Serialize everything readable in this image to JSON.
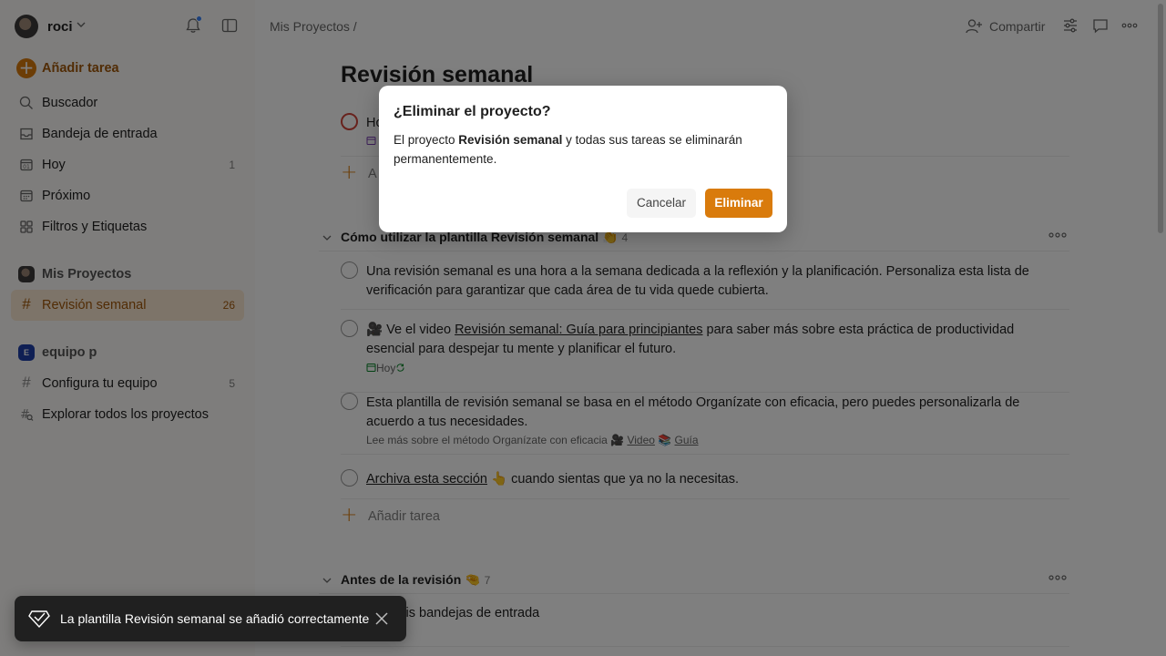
{
  "user": {
    "name": "roci"
  },
  "sidebar": {
    "add_task": "Añadir tarea",
    "items": [
      {
        "label": "Buscador",
        "count": ""
      },
      {
        "label": "Bandeja de entrada",
        "count": ""
      },
      {
        "label": "Hoy",
        "count": "1"
      },
      {
        "label": "Próximo",
        "count": ""
      },
      {
        "label": "Filtros y Etiquetas",
        "count": ""
      }
    ],
    "my_projects": "Mis Proyectos",
    "projects": [
      {
        "label": "Revisión semanal",
        "count": "26"
      }
    ],
    "team": {
      "badge": "E",
      "name": "equipo p"
    },
    "team_projects": [
      {
        "label": "Configura tu equipo",
        "count": "5"
      }
    ],
    "explore": "Explorar todos los proyectos"
  },
  "topbar": {
    "breadcrumb": "Mis Proyectos /",
    "share": "Compartir"
  },
  "page": {
    "title": "Revisión semanal",
    "first_task_partial": "Ho",
    "add_partial": "A",
    "add_task": "Añadir tarea"
  },
  "sections": [
    {
      "title": "Cómo utilizar la plantilla Revisión semanal",
      "emoji": "👏",
      "count": "4",
      "tasks": [
        {
          "text": "Una revisión semanal es una hora a la semana dedicada a la reflexión y la planificación. Personaliza esta lista de verificación para garantizar que cada área de tu vida quede cubierta."
        },
        {
          "prefix": "🎥 Ve el video ",
          "link": "Revisión semanal: Guía para principiantes",
          "suffix": " para saber más sobre esta práctica de productividad esencial para despejar tu mente y planificar el futuro.",
          "due": "Hoy"
        },
        {
          "text": "Esta plantilla de revisión semanal se basa en el método Organízate con eficacia, pero puedes personalizarla de acuerdo a tus necesidades.",
          "desc_prefix": "Lee más sobre el método Organízate con eficacia 🎥 ",
          "desc_link1": "Video",
          "desc_mid": " 📚 ",
          "desc_link2": "Guía"
        },
        {
          "link": "Archiva esta sección",
          "suffix": " 👆 cuando sientas que ya no la necesitas."
        }
      ]
    },
    {
      "title": "Antes de la revisión",
      "emoji": "🤏",
      "count": "7",
      "tasks": [
        {
          "text": "…ar mis bandejas de entrada"
        }
      ]
    }
  ],
  "dialog": {
    "title": "¿Eliminar el proyecto?",
    "body_prefix": "El proyecto ",
    "body_bold": "Revisión semanal",
    "body_suffix": " y todas sus tareas se eliminarán permanentemente.",
    "cancel": "Cancelar",
    "confirm": "Eliminar"
  },
  "toast": {
    "message": "La plantilla Revisión semanal se añadió correctamente"
  },
  "colors": {
    "accent": "#d97b0c",
    "accent_text": "#a3580a",
    "active_bg": "#fbe9d2",
    "overdue": "#d1453b",
    "due_today": "#058527"
  }
}
